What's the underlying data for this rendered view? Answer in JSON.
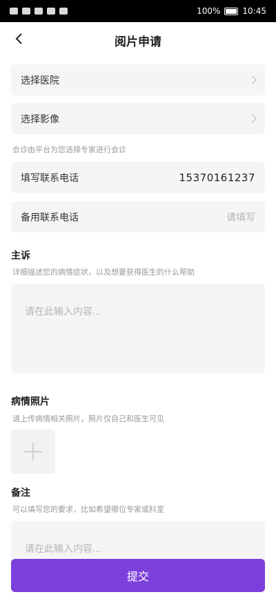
{
  "status_bar": {
    "battery": "100%",
    "time": "10:45"
  },
  "nav": {
    "title": "阅片申请"
  },
  "fields": {
    "select_hospital": "选择医院",
    "select_image": "选择影像",
    "consult_hint": "会诊由平台为您选择专家进行会诊",
    "contact_phone_label": "填写联系电话",
    "contact_phone_value": "15370161237",
    "backup_phone_label": "备用联系电话",
    "backup_phone_placeholder": "请填写"
  },
  "complaint": {
    "title": "主诉",
    "hint": "详细描述您的病情症状，以及想要获得医生的什么帮助",
    "placeholder": "请在此输入内容..."
  },
  "photos": {
    "title": "病情照片",
    "hint": "请上传病情相关照片，照片仅自己和医生可见"
  },
  "remark": {
    "title": "备注",
    "hint": "可以填写您的要求，比如希望哪位专家或科室",
    "placeholder": "请在此输入内容..."
  },
  "submit_label": "提交",
  "colors": {
    "accent": "#7c3fdb",
    "card_bg": "#f5f5f7"
  }
}
